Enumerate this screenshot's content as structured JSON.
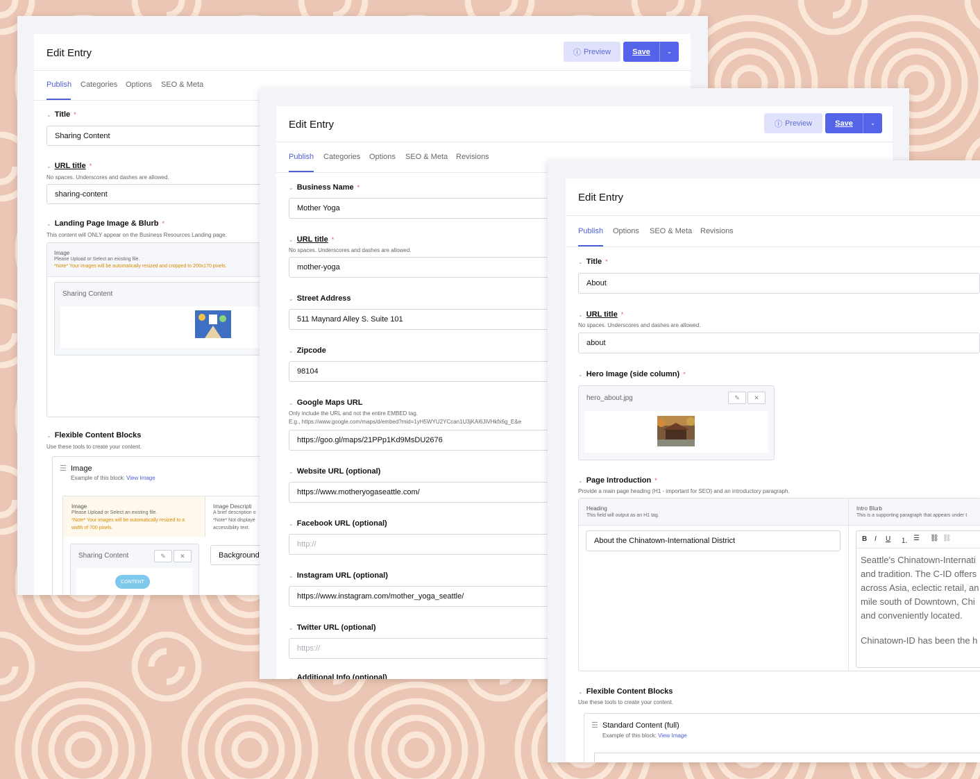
{
  "colors": {
    "background": "#ecc6b4",
    "accent": "#5464e8",
    "required": "#e05a5a"
  },
  "w1": {
    "title": "Edit Entry",
    "preview": "Preview",
    "save": "Save",
    "tabs": [
      "Publish",
      "Categories",
      "Options",
      "SEO & Meta"
    ],
    "title_label": "Title",
    "title_value": "Sharing Content",
    "url_label": "URL title",
    "url_help": "No spaces. Underscores and dashes are allowed.",
    "url_value": "sharing-content",
    "landing_label": "Landing Page Image & Blurb",
    "landing_help": "This content will ONLY appear on the Business Resources Landing page.",
    "image_label": "Image",
    "image_help": "Please Upload or Select an existing file.",
    "image_note": "*Note* Your images will be automatically resized and cropped to 200x170 pixels.",
    "file_name": "Sharing Content",
    "flex_label": "Flexible Content Blocks",
    "flex_help": "Use these tools to create your content.",
    "block_title": "Image",
    "block_example": "Example of this block:",
    "view_image": "View Image",
    "block_image_label": "Image",
    "block_image_help": "Please Upload or Select an existing file.",
    "block_image_note1": "*Note* Your images will be automatically resized to a",
    "block_image_note2": "width of 700 pixels.",
    "desc_label": "Image Descripti",
    "desc_help1": "A brief description o",
    "desc_help2": "*Note* Not displaye",
    "desc_help3": "accessibility text.",
    "block_file": "Sharing Content",
    "desc_value": "Background",
    "content_img_text": "CONTENT"
  },
  "w2": {
    "title": "Edit Entry",
    "preview": "Preview",
    "save": "Save",
    "tabs": [
      "Publish",
      "Categories",
      "Options",
      "SEO & Meta",
      "Revisions"
    ],
    "business_label": "Business Name",
    "business_value": "Mother Yoga",
    "url_label": "URL title",
    "url_help": "No spaces. Underscores and dashes are allowed.",
    "url_value": "mother-yoga",
    "street_label": "Street Address",
    "street_value": "511 Maynard Alley S. Suite 101",
    "zip_label": "Zipcode",
    "zip_value": "98104",
    "maps_label": "Google Maps URL",
    "maps_help1": "Only include the URL and not the entire EMBED tag.",
    "maps_help2": "E.g., https://www.google.com/maps/d/embed?mid=1yH5WYU2YCcan1U3jKAl6JiVHkfx6g_E&e",
    "maps_value": "https://goo.gl/maps/21PPp1Kd9MsDU2676",
    "website_label": "Website URL (optional)",
    "website_value": "https://www.motheryogaseattle.com/",
    "facebook_label": "Facebook URL (optional)",
    "facebook_placeholder": "http://",
    "instagram_label": "Instagram URL (optional)",
    "instagram_value": "https://www.instagram.com/mother_yoga_seattle/",
    "twitter_label": "Twitter URL (optional)",
    "twitter_placeholder": "https://",
    "additional_label": "Additional Info (optional)"
  },
  "w3": {
    "title": "Edit Entry",
    "tabs": [
      "Publish",
      "Options",
      "SEO & Meta",
      "Revisions"
    ],
    "title_label": "Title",
    "title_value": "About",
    "url_label": "URL title",
    "url_help": "No spaces. Underscores and dashes are allowed.",
    "url_value": "about",
    "hero_label": "Hero Image (side column)",
    "hero_file": "hero_about.jpg",
    "intro_label": "Page Introduction",
    "intro_help": "Provide a main page heading (H1 - important for SEO) and an introductory paragraph.",
    "heading_col": "Heading",
    "heading_col_help": "This field will output as an H1 tag.",
    "blurb_col": "Intro Blurb",
    "blurb_col_help": "This is a supporting paragraph that appears under t",
    "heading_value": "About the Chinatown-International District",
    "blurb_lines": [
      "Seattle's Chinatown-Internati",
      "and tradition. The C-ID offers",
      "across Asia, eclectic retail, an",
      "mile south of Downtown, Chi",
      "and conveniently located."
    ],
    "blurb_line2": "Chinatown-ID has been the h",
    "flex_label": "Flexible Content Blocks",
    "flex_help": "Use these tools to create your content.",
    "block_title": "Standard Content (full)",
    "block_example": "Example of this block:",
    "view_image": "View Image"
  }
}
